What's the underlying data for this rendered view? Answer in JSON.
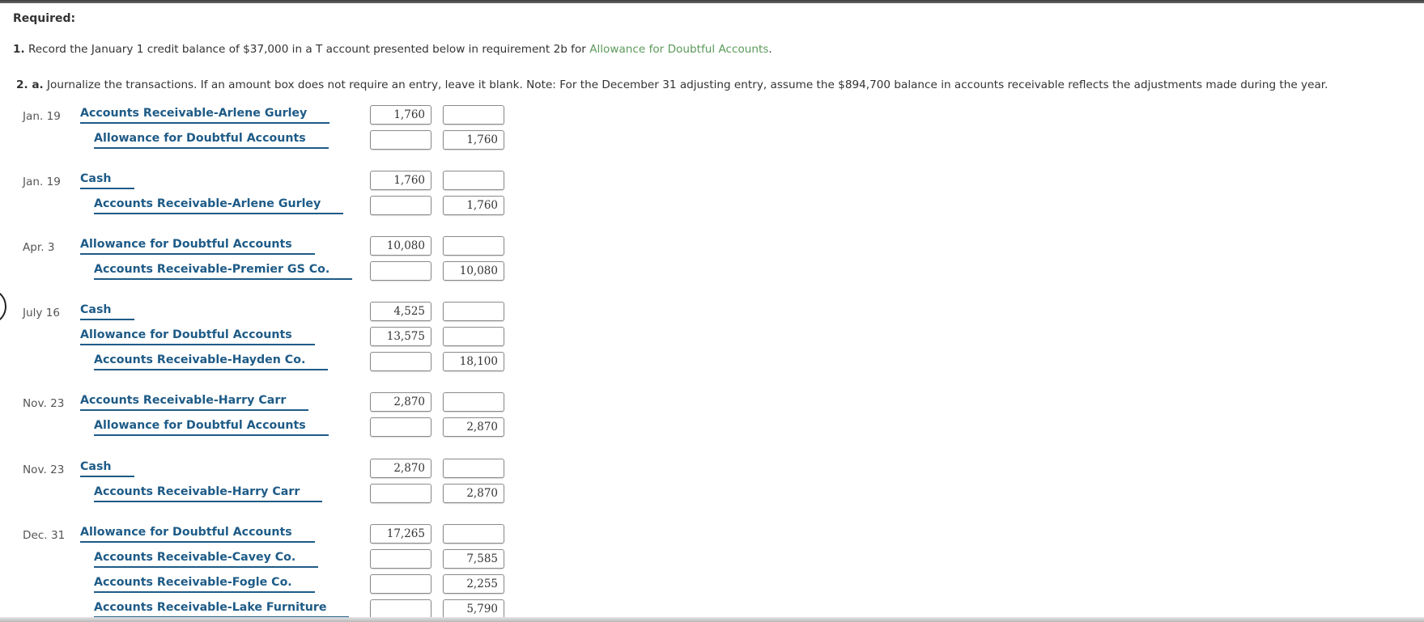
{
  "header": {
    "required_label": "Required:"
  },
  "requirement_1": {
    "number": "1.",
    "text": "Record the January 1 credit balance of $37,000 in a T account presented below in requirement 2b for",
    "link": "Allowance for Doubtful Accounts",
    "end": "."
  },
  "requirement_2a": {
    "number": "2. a.",
    "text": "Journalize the transactions. If an amount box does not require an entry, leave it blank. Note: For the December 31 adjusting entry, assume the $894,700 balance in accounts receivable reflects the adjustments made during the year."
  },
  "entries": [
    {
      "date": "Jan. 19",
      "lines": [
        {
          "account": "Accounts Receivable-Arlene Gurley",
          "debit": "1,760",
          "credit": ""
        },
        {
          "account": "Allowance for Doubtful Accounts",
          "debit": "",
          "credit": "1,760"
        }
      ]
    },
    {
      "date": "Jan. 19",
      "lines": [
        {
          "account": "Cash",
          "debit": "1,760",
          "credit": ""
        },
        {
          "account": "Accounts Receivable-Arlene Gurley",
          "debit": "",
          "credit": "1,760"
        }
      ]
    },
    {
      "date": "Apr. 3",
      "lines": [
        {
          "account": "Allowance for Doubtful Accounts",
          "debit": "10,080",
          "credit": ""
        },
        {
          "account": "Accounts Receivable-Premier GS Co.",
          "debit": "",
          "credit": "10,080"
        }
      ]
    },
    {
      "date": "July 16",
      "lines": [
        {
          "account": "Cash",
          "debit": "4,525",
          "credit": ""
        },
        {
          "account": "Allowance for Doubtful Accounts",
          "debit": "13,575",
          "credit": ""
        },
        {
          "account": "Accounts Receivable-Hayden Co.",
          "debit": "",
          "credit": "18,100"
        }
      ]
    },
    {
      "date": "Nov. 23",
      "lines": [
        {
          "account": "Accounts Receivable-Harry Carr",
          "debit": "2,870",
          "credit": ""
        },
        {
          "account": "Allowance for Doubtful Accounts",
          "debit": "",
          "credit": "2,870"
        }
      ]
    },
    {
      "date": "Nov. 23",
      "lines": [
        {
          "account": "Cash",
          "debit": "2,870",
          "credit": ""
        },
        {
          "account": "Accounts Receivable-Harry Carr",
          "debit": "",
          "credit": "2,870"
        }
      ]
    },
    {
      "date": "Dec. 31",
      "lines": [
        {
          "account": "Allowance for Doubtful Accounts",
          "debit": "17,265",
          "credit": ""
        },
        {
          "account": "Accounts Receivable-Cavey Co.",
          "debit": "",
          "credit": "7,585"
        },
        {
          "account": "Accounts Receivable-Fogle Co.",
          "debit": "",
          "credit": "2,255"
        },
        {
          "account": "Accounts Receivable-Lake Furniture",
          "debit": "",
          "credit": "5,790"
        }
      ]
    }
  ]
}
